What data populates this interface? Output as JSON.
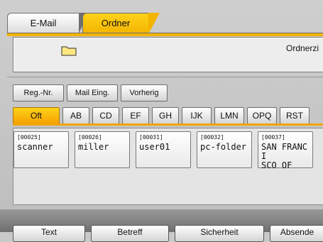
{
  "tabs": {
    "email": "E-Mail",
    "folder": "Ordner"
  },
  "destination_field": {
    "label": "Ordnerzi"
  },
  "sort_buttons": [
    "Reg.-Nr.",
    "Mail Eing.",
    "Vorherig"
  ],
  "index_tabs": [
    "Oft",
    "AB",
    "CD",
    "EF",
    "GH",
    "IJK",
    "LMN",
    "OPQ",
    "RST"
  ],
  "entries": [
    {
      "num": "[00025]",
      "name": "scanner"
    },
    {
      "num": "[00026]",
      "name": "miller"
    },
    {
      "num": "[00031]",
      "name": "user01"
    },
    {
      "num": "[00032]",
      "name": "pc-folder"
    },
    {
      "num": "[00037]",
      "name": "SAN FRANCI\nSCO OF"
    }
  ],
  "bottom_buttons": [
    "Text",
    "Betreff",
    "Sicherheit",
    "Absende"
  ],
  "colors": {
    "accent": "#f2b400",
    "background": "#c9c9c9"
  }
}
